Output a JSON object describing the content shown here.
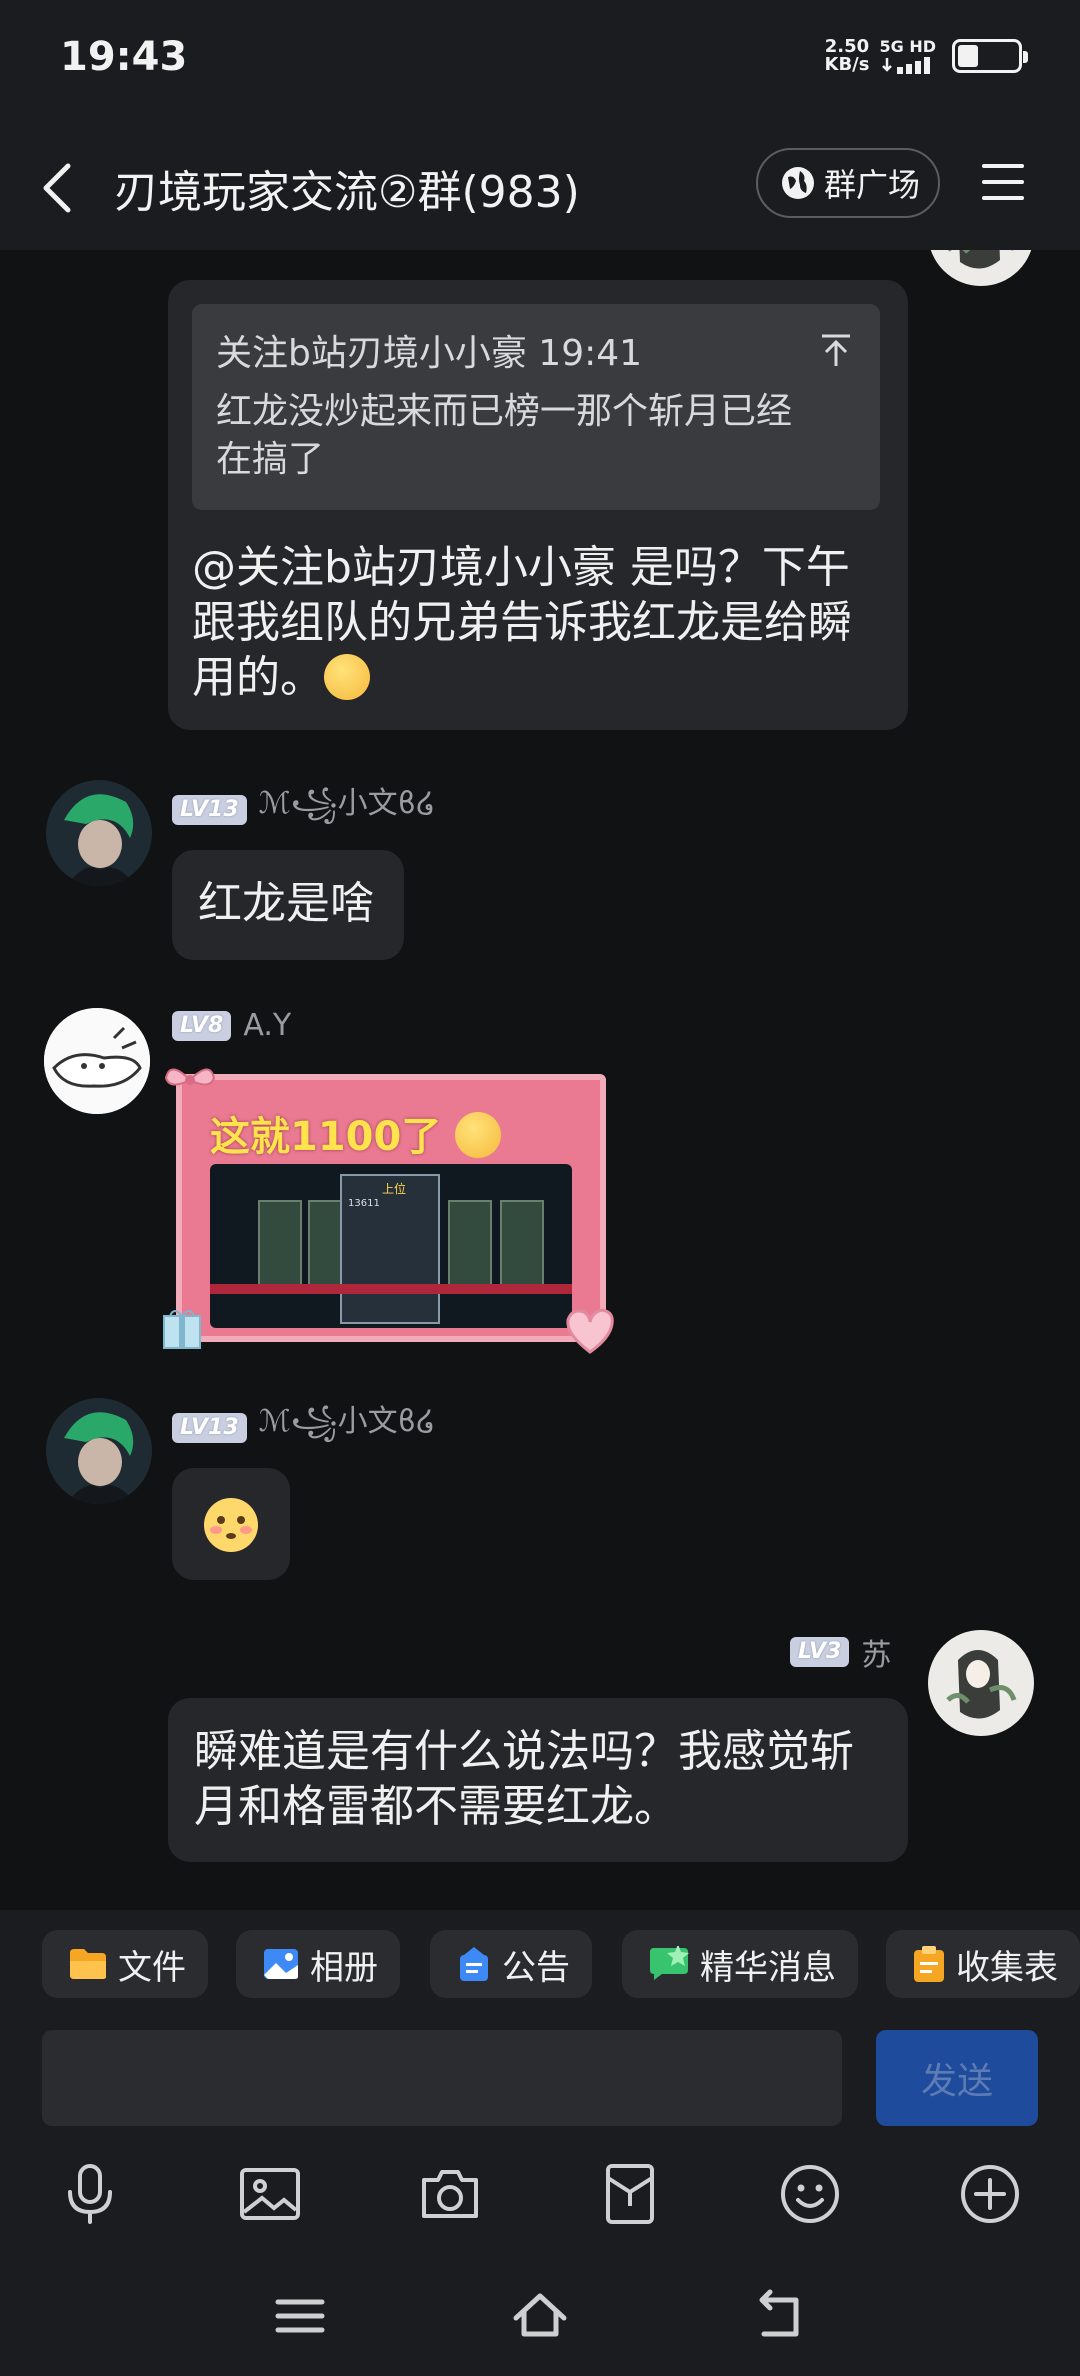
{
  "status_bar": {
    "time": "19:43",
    "net_speed_value": "2.50",
    "net_speed_unit": "KB/s",
    "network": "5G",
    "hd": "HD",
    "battery_level": 0.35
  },
  "header": {
    "title": "刃境玩家交流②群(983)",
    "square_label": "群广场"
  },
  "messages": [
    {
      "quote_author": "关注b站刃境小小豪 19:41",
      "quote_text": "红龙没炒起来而已榜一那个斩月已经在搞了",
      "text": "@关注b站刃境小小豪 是吗？下午跟我组队的兄弟告诉我红龙是给瞬用的。"
    },
    {
      "level": "LV13",
      "nickname": "ℳ꧁小文ϐ໒",
      "text": "红龙是啥"
    },
    {
      "level": "LV8",
      "nickname": "A.Y",
      "text": "这就1100了"
    },
    {
      "level": "LV13",
      "nickname": "ℳ꧁小文ϐ໒"
    },
    {
      "level": "LV3",
      "nickname": "苏",
      "text": "瞬难道是有什么说法吗？我感觉斩月和格雷都不需要红龙。"
    }
  ],
  "screenshot_thumb": {
    "tag": "上位",
    "number": "13611"
  },
  "quick_bar": {
    "items": [
      "文件",
      "相册",
      "公告",
      "精华消息",
      "收集表"
    ]
  },
  "composer": {
    "send_label": "发送"
  },
  "colors": {
    "background": "#111214",
    "bubble": "#26272b",
    "bar": "#1b1c1f",
    "send_button": "#1f4b9c",
    "card_pink": "#e97a92"
  },
  "icons": {
    "tools": [
      "microphone-icon",
      "image-icon",
      "camera-icon",
      "red-packet-icon",
      "emoji-icon",
      "plus-icon"
    ],
    "nav": [
      "recents-icon",
      "home-icon",
      "back-nav-icon"
    ]
  }
}
